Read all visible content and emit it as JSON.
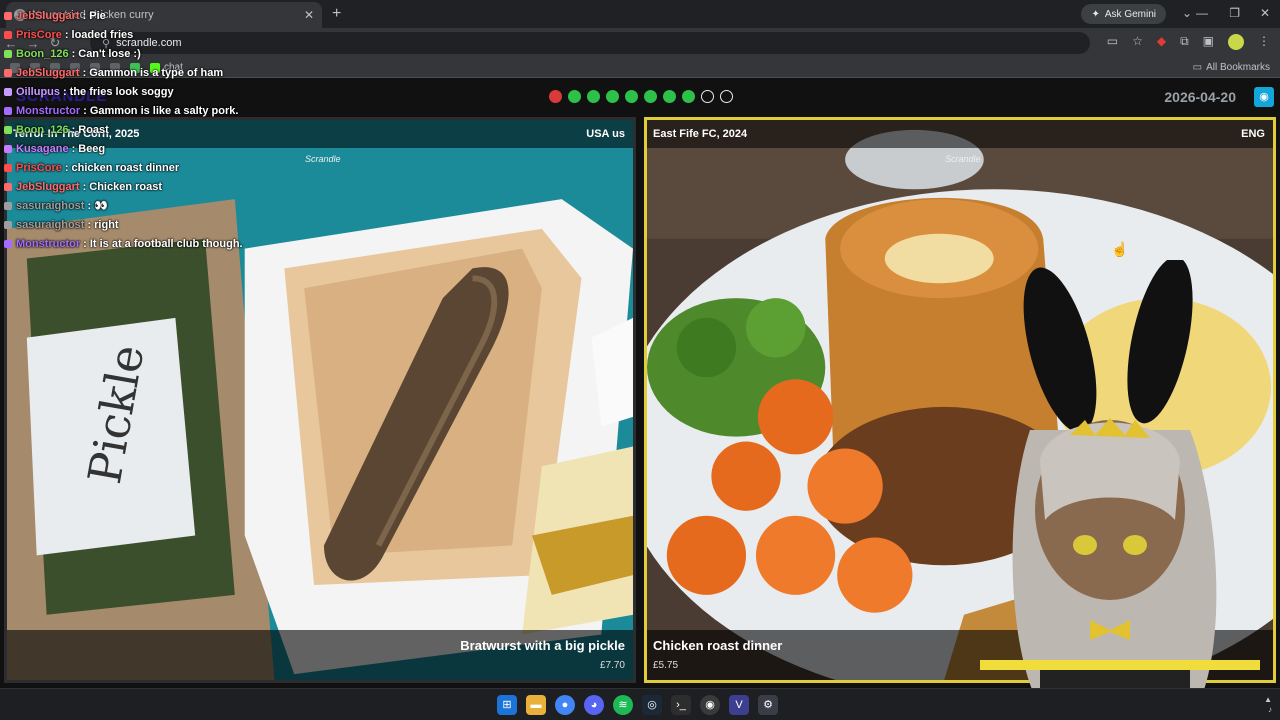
{
  "browser": {
    "tab_title": "Never tried chicken curry",
    "url": "scrandle.com",
    "ask_gemini": "Ask Gemini",
    "bookmark_chat": "chat",
    "all_bookmarks": "All Bookmarks"
  },
  "app": {
    "brand": "SCRANDLE",
    "date": "2026-04-20",
    "progress": [
      "red",
      "green",
      "green",
      "green",
      "green",
      "green",
      "green",
      "green",
      "empty",
      "empty"
    ]
  },
  "left_card": {
    "location": "Terror In The Corn, 2025",
    "country": "USA us",
    "watermark": "Scrandle",
    "dish": "Bratwurst with a big pickle",
    "price": "£7.70"
  },
  "right_card": {
    "location": "East Fife FC, 2024",
    "country": "ENG",
    "watermark": "Scrandle",
    "dish": "Chicken roast dinner",
    "price": "£5.75"
  },
  "chat": [
    {
      "user": "JebSluggart",
      "msg": "Pie",
      "color": "#ff6b6b"
    },
    {
      "user": "PrisCore",
      "msg": "loaded fries",
      "color": "#ff4d4d"
    },
    {
      "user": "Boon_126",
      "msg": "Can't lose :)",
      "color": "#7fe05a"
    },
    {
      "user": "JebSluggart",
      "msg": "Gammon is a type of ham",
      "color": "#ff6b6b"
    },
    {
      "user": "Oillupus",
      "msg": "the fries look soggy",
      "color": "#c99bff"
    },
    {
      "user": "Monstructor",
      "msg": "Gammon is like a salty pork.",
      "color": "#a36bff"
    },
    {
      "user": "Boon_126",
      "msg": "Roast",
      "color": "#7fe05a"
    },
    {
      "user": "Kusagane",
      "msg": "Beeg",
      "color": "#c77dff"
    },
    {
      "user": "PrisCore",
      "msg": "chicken roast dinner",
      "color": "#ff4d4d"
    },
    {
      "user": "JebSluggart",
      "msg": "Chicken roast",
      "color": "#ff6b6b"
    },
    {
      "user": "sasuraighost",
      "msg": "👀",
      "color": "#9e9e9e"
    },
    {
      "user": "sasuraighost",
      "msg": "right",
      "color": "#9e9e9e"
    },
    {
      "user": "Monstructor",
      "msg": "It is at a football club though.",
      "color": "#a36bff"
    }
  ]
}
